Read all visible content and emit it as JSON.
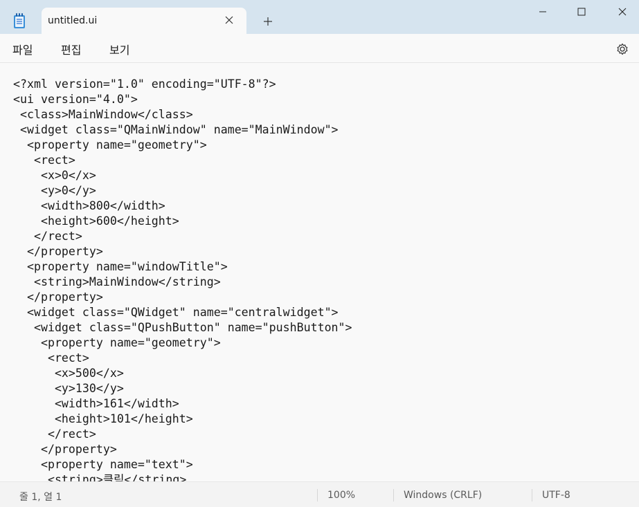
{
  "tab": {
    "title": "untitled.ui",
    "close_icon": "close-icon"
  },
  "new_tab_icon": "plus-icon",
  "window_controls": [
    "minimize-icon",
    "maximize-icon",
    "close-icon"
  ],
  "menu": {
    "items": [
      "파일",
      "편집",
      "보기"
    ],
    "settings_icon": "gear-icon"
  },
  "editor": {
    "lines": [
      "<?xml version=\"1.0\" encoding=\"UTF-8\"?>",
      "<ui version=\"4.0\">",
      " <class>MainWindow</class>",
      " <widget class=\"QMainWindow\" name=\"MainWindow\">",
      "  <property name=\"geometry\">",
      "   <rect>",
      "    <x>0</x>",
      "    <y>0</y>",
      "    <width>800</width>",
      "    <height>600</height>",
      "   </rect>",
      "  </property>",
      "  <property name=\"windowTitle\">",
      "   <string>MainWindow</string>",
      "  </property>",
      "  <widget class=\"QWidget\" name=\"centralwidget\">",
      "   <widget class=\"QPushButton\" name=\"pushButton\">",
      "    <property name=\"geometry\">",
      "     <rect>",
      "      <x>500</x>",
      "      <y>130</y>",
      "      <width>161</width>",
      "      <height>101</height>",
      "     </rect>",
      "    </property>",
      "    <property name=\"text\">",
      "     <string>클릭</string>"
    ]
  },
  "status": {
    "position": "줄 1, 열 1",
    "zoom": "100%",
    "line_ending": "Windows (CRLF)",
    "encoding": "UTF-8"
  },
  "colors": {
    "titlebar": "#d6e4ef",
    "background": "#f9f9f9",
    "statusbar": "#f3f3f3",
    "icon_blue": "#3a7bd5"
  }
}
